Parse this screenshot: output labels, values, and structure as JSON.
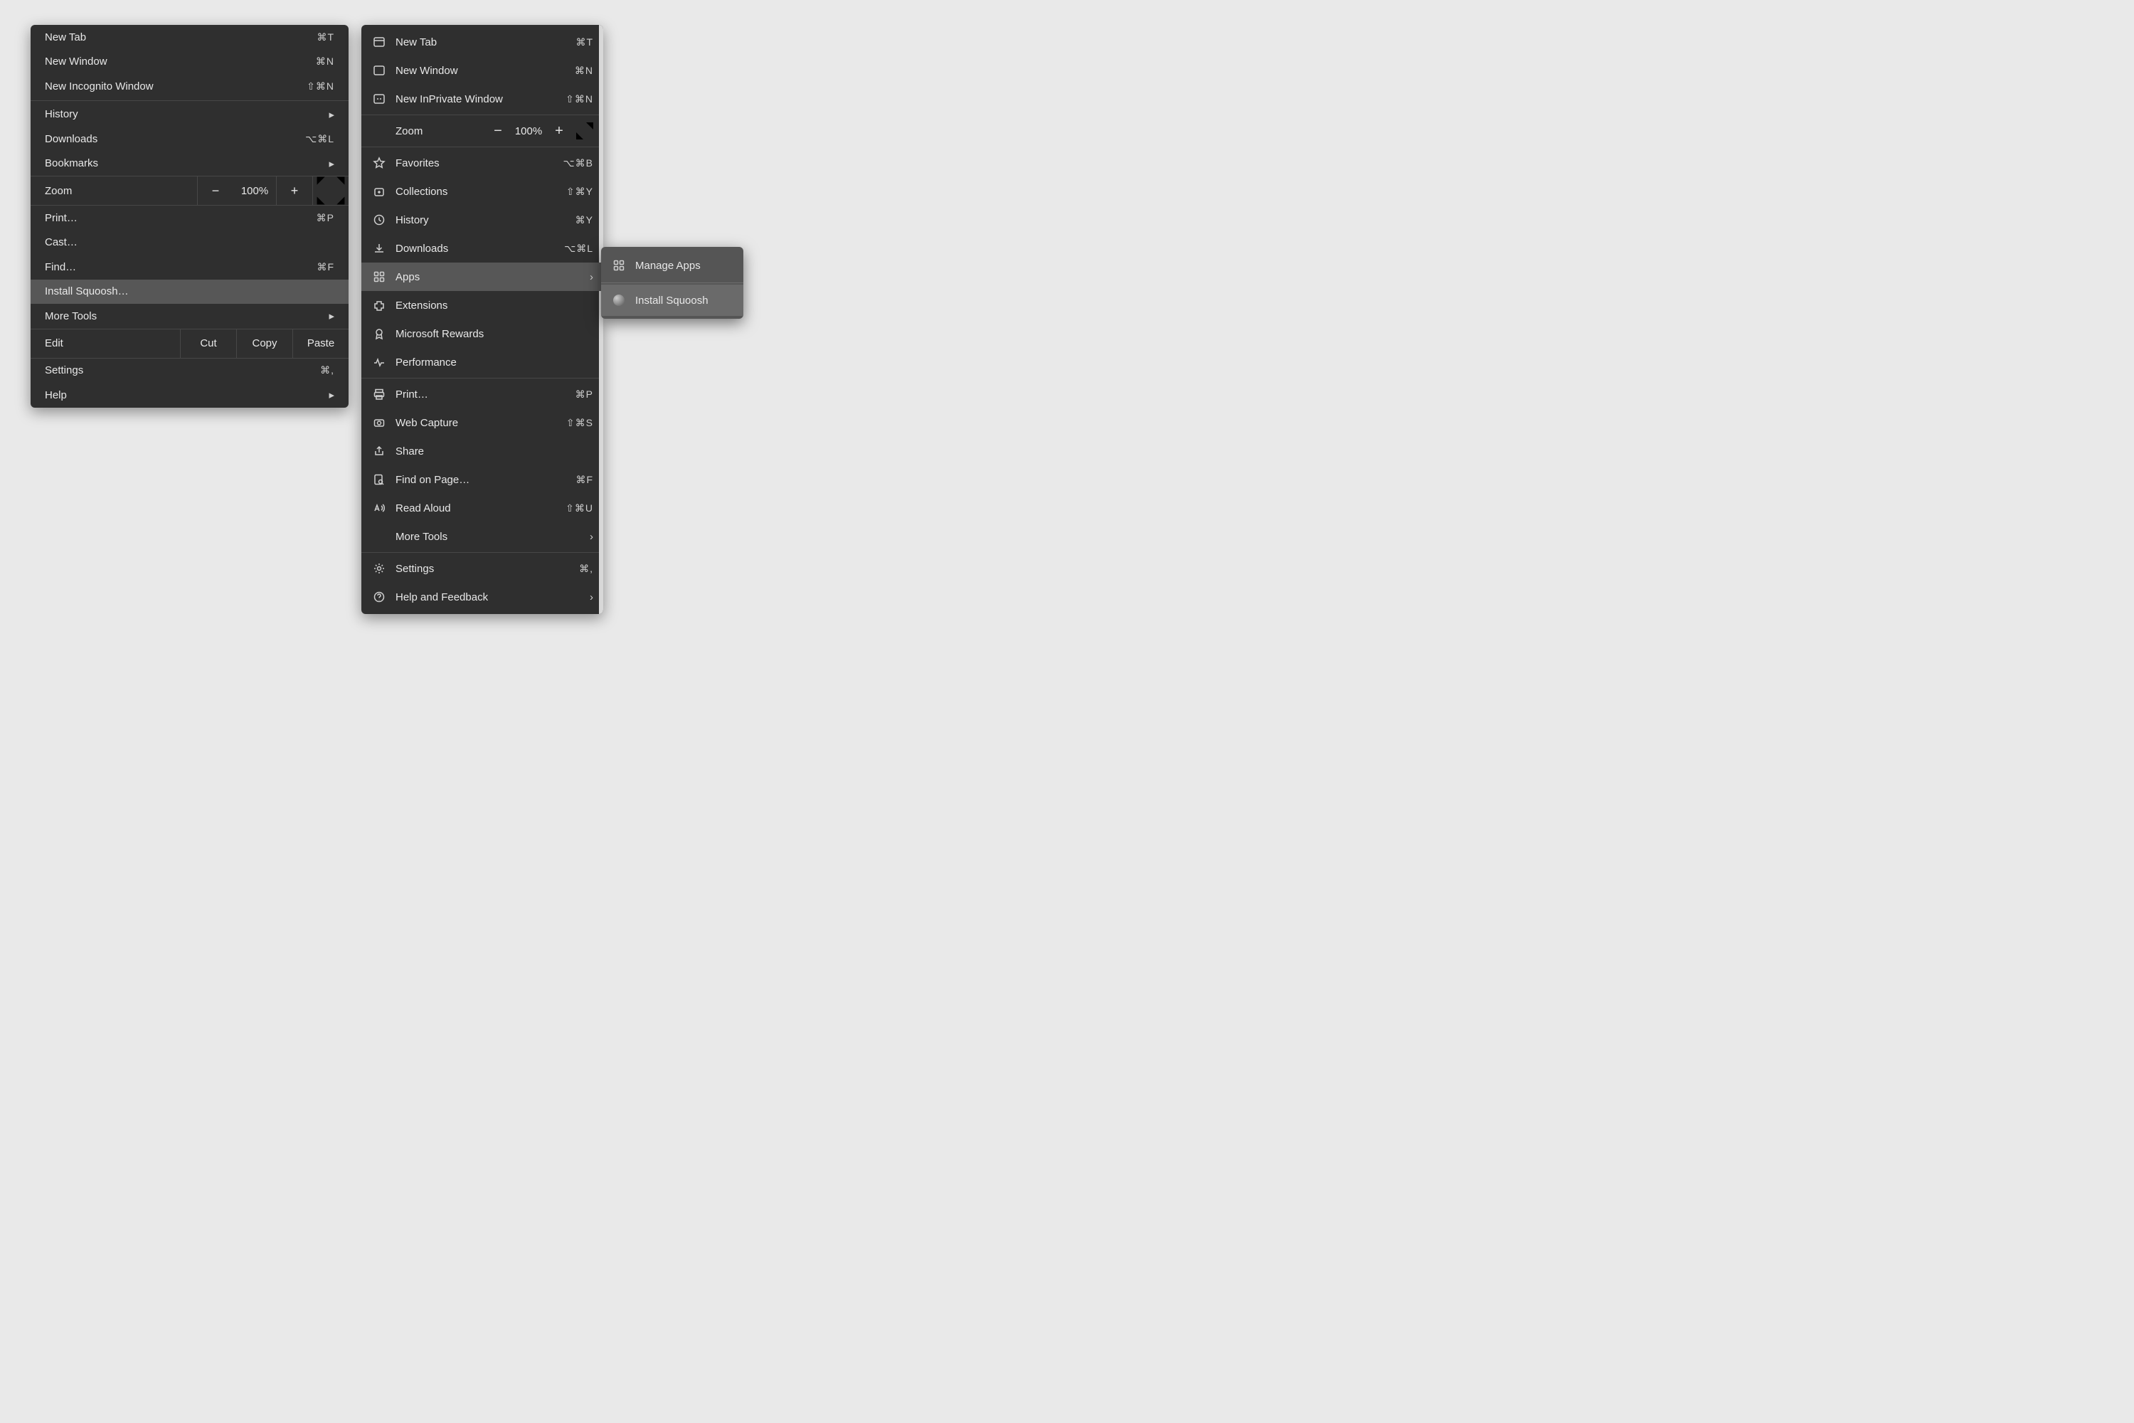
{
  "chrome": {
    "group1": [
      {
        "label": "New Tab",
        "shortcut": "⌘T"
      },
      {
        "label": "New Window",
        "shortcut": "⌘N"
      },
      {
        "label": "New Incognito Window",
        "shortcut": "⇧⌘N"
      }
    ],
    "history": {
      "label": "History"
    },
    "downloads": {
      "label": "Downloads",
      "shortcut": "⌥⌘L"
    },
    "bookmarks": {
      "label": "Bookmarks"
    },
    "zoom": {
      "label": "Zoom",
      "value": "100%"
    },
    "print": {
      "label": "Print…",
      "shortcut": "⌘P"
    },
    "cast": {
      "label": "Cast…"
    },
    "find": {
      "label": "Find…",
      "shortcut": "⌘F"
    },
    "install": {
      "label": "Install Squoosh…"
    },
    "moretools": {
      "label": "More Tools"
    },
    "edit": {
      "label": "Edit",
      "cut": "Cut",
      "copy": "Copy",
      "paste": "Paste"
    },
    "settings": {
      "label": "Settings",
      "shortcut": "⌘,"
    },
    "help": {
      "label": "Help"
    }
  },
  "edge": {
    "newtab": {
      "label": "New Tab",
      "shortcut": "⌘T"
    },
    "newwindow": {
      "label": "New Window",
      "shortcut": "⌘N"
    },
    "newinprivate": {
      "label": "New InPrivate Window",
      "shortcut": "⇧⌘N"
    },
    "zoom": {
      "label": "Zoom",
      "value": "100%"
    },
    "favorites": {
      "label": "Favorites",
      "shortcut": "⌥⌘B"
    },
    "collections": {
      "label": "Collections",
      "shortcut": "⇧⌘Y"
    },
    "history": {
      "label": "History",
      "shortcut": "⌘Y"
    },
    "downloads": {
      "label": "Downloads",
      "shortcut": "⌥⌘L"
    },
    "apps": {
      "label": "Apps"
    },
    "extensions": {
      "label": "Extensions"
    },
    "rewards": {
      "label": "Microsoft Rewards"
    },
    "performance": {
      "label": "Performance"
    },
    "print": {
      "label": "Print…",
      "shortcut": "⌘P"
    },
    "webcapture": {
      "label": "Web Capture",
      "shortcut": "⇧⌘S"
    },
    "share": {
      "label": "Share"
    },
    "findonpage": {
      "label": "Find on Page…",
      "shortcut": "⌘F"
    },
    "readaloud": {
      "label": "Read Aloud",
      "shortcut": "⇧⌘U"
    },
    "moretools": {
      "label": "More Tools"
    },
    "settings": {
      "label": "Settings",
      "shortcut": "⌘,"
    },
    "help": {
      "label": "Help and Feedback"
    }
  },
  "submenu": {
    "manage": {
      "label": "Manage Apps"
    },
    "install": {
      "label": "Install Squoosh"
    }
  }
}
